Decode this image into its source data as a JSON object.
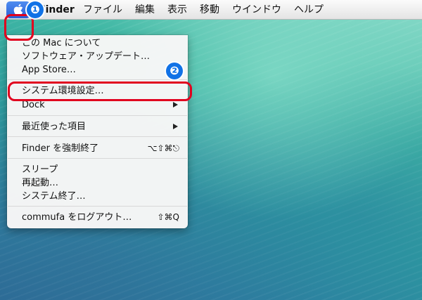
{
  "menubar": {
    "apple_icon": "apple-icon",
    "items": [
      "Finder",
      "ファイル",
      "編集",
      "表示",
      "移動",
      "ウインドウ",
      "ヘルプ"
    ]
  },
  "annotations": {
    "badge_1": "❶",
    "badge_2": "❷",
    "color": "#e1001e",
    "badge_color": "#1172e6"
  },
  "apple_menu": {
    "about": "この Mac について",
    "software_update": "ソフトウェア・アップデート…",
    "app_store": "App Store…",
    "system_prefs": "システム環境設定…",
    "dock": "Dock",
    "recent_items": "最近使った項目",
    "force_quit": "Finder を強制終了",
    "force_quit_shortcut": "⌥⇧⌘⎋",
    "sleep": "スリープ",
    "restart": "再起動…",
    "shutdown": "システム終了…",
    "logout": "commufa をログアウト…",
    "logout_shortcut": "⇧⌘Q"
  }
}
